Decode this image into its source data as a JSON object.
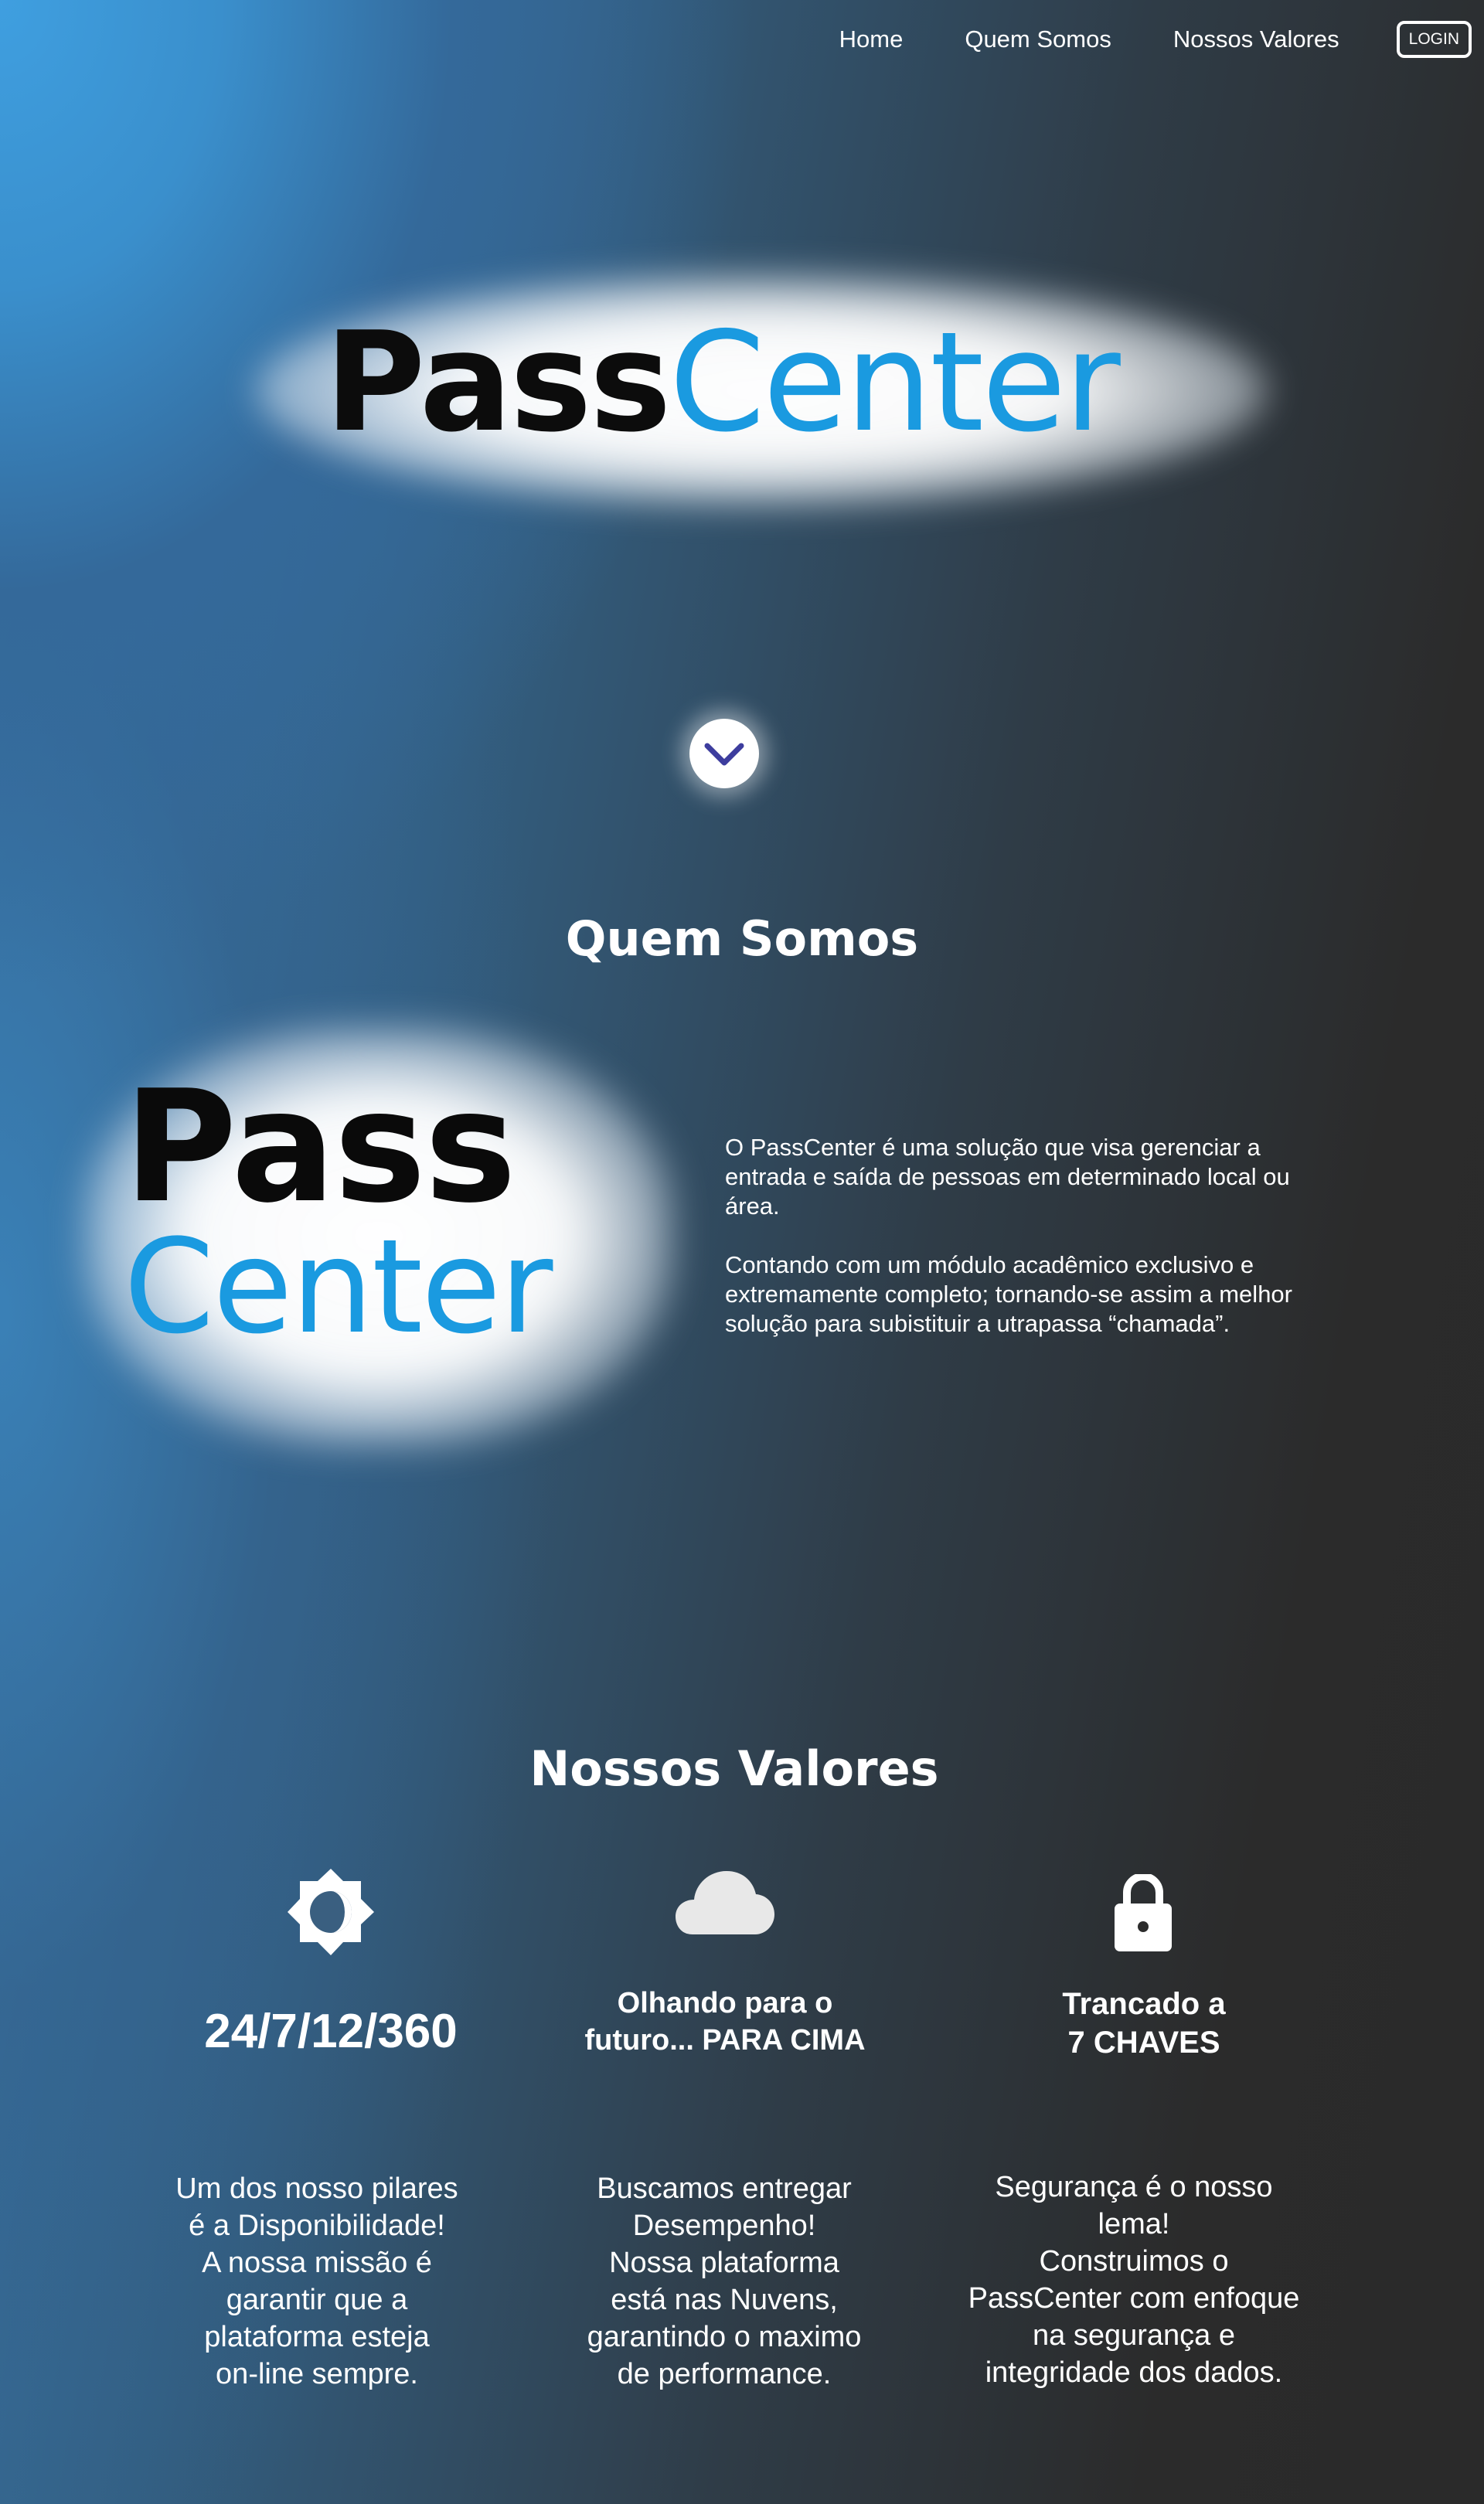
{
  "nav": {
    "links": [
      "Home",
      "Quem Somos",
      "Nossos Valores"
    ],
    "login_label": "LOGIN"
  },
  "hero": {
    "logo_part1": "Pass",
    "logo_part2": "Center",
    "scroll_icon": "chevron-down-icon"
  },
  "about": {
    "title": "Quem Somos",
    "logo_part1": "Pass",
    "logo_part2": "Center",
    "paragraphs": [
      "O PassCenter é uma solução que visa gerenciar a entrada e saída de pessoas em determinado local ou área.",
      "Contando com um módulo acadêmico exclusivo e extremamente completo; tornando-se assim a melhor solução para subistituir a utrapassa “chamada”."
    ]
  },
  "values": {
    "title": "Nossos Valores",
    "items": [
      {
        "icon": "brightness-icon",
        "title": "24/7/12/360",
        "description": "Um dos nosso pilares\né a Disponibilidade!\nA nossa missão é\ngarantir que a\nplataforma esteja\non-line sempre."
      },
      {
        "icon": "cloud-icon",
        "title_line1": "Olhando para o",
        "title_line2": "futuro... PARA CIMA",
        "description": "Buscamos entregar\nDesempenho!\nNossa plataforma\nestá nas Nuvens,\ngarantindo o maximo\nde performance."
      },
      {
        "icon": "lock-icon",
        "title_line1": "Trancado a",
        "title_line2": "7 CHAVES",
        "description": "Segurança é o nosso\nlema!\nConstruimos o\nPassCenter com enfoque\nna segurança e\nintegridade dos dados."
      }
    ]
  },
  "colors": {
    "brand_blue": "#1a9ae0",
    "brand_black": "#0c0c0c",
    "chevron": "#3d3d9e"
  }
}
